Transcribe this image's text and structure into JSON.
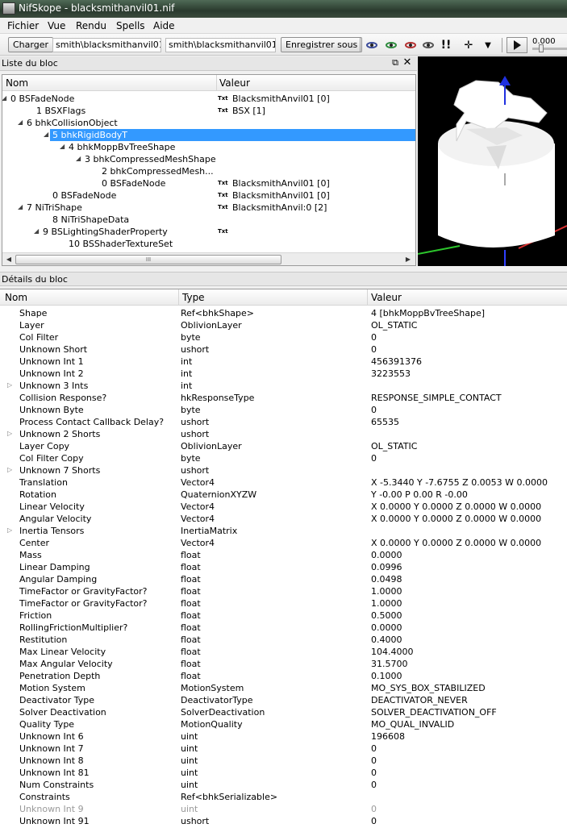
{
  "window": {
    "title": "NifSkope - blacksmithanvil01.nif"
  },
  "menu": {
    "items": [
      "Fichier",
      "Vue",
      "Rendu",
      "Spells",
      "Aide"
    ]
  },
  "toolbar": {
    "load_label": "Charger",
    "load_path": "smith\\blacksmithanvil01.nif",
    "save_path": "smith\\blacksmithanvil01.nif",
    "save_label": "Enregistrer sous",
    "time_value": "0.000"
  },
  "block_list": {
    "title": "Liste du bloc",
    "columns": {
      "name": "Nom",
      "value": "Valeur"
    },
    "rows": [
      {
        "name": "0 BSFadeNode",
        "txt": "Txt",
        "value": "BlacksmithAnvil01 [0]",
        "expander": "open"
      },
      {
        "name": "1 BSXFlags",
        "txt": "Txt",
        "value": "BSX [1]",
        "expander": ""
      },
      {
        "name": "6 bhkCollisionObject",
        "txt": "",
        "value": "",
        "expander": "open"
      },
      {
        "name": "5 bhkRigidBodyT",
        "txt": "",
        "value": "",
        "expander": "open"
      },
      {
        "name": "4 bhkMoppBvTreeShape",
        "txt": "",
        "value": "",
        "expander": "open"
      },
      {
        "name": "3 bhkCompressedMeshShape",
        "txt": "",
        "value": "",
        "expander": "open"
      },
      {
        "name": "2 bhkCompressedMesh...",
        "txt": "",
        "value": "",
        "expander": ""
      },
      {
        "name": "0 BSFadeNode",
        "txt": "Txt",
        "value": "BlacksmithAnvil01 [0]",
        "expander": ""
      },
      {
        "name": "0 BSFadeNode",
        "txt": "Txt",
        "value": "BlacksmithAnvil01 [0]",
        "expander": ""
      },
      {
        "name": "7 NiTriShape",
        "txt": "Txt",
        "value": "BlacksmithAnvil:0 [2]",
        "expander": "open"
      },
      {
        "name": "8 NiTriShapeData",
        "txt": "",
        "value": "",
        "expander": ""
      },
      {
        "name": "9 BSLightingShaderProperty",
        "txt": "Txt",
        "value": "",
        "expander": "open"
      },
      {
        "name": "10 BSShaderTextureSet",
        "txt": "",
        "value": "",
        "expander": ""
      }
    ],
    "scroll_thumb_grip": "III"
  },
  "details": {
    "title": "Détails du bloc",
    "columns": {
      "name": "Nom",
      "type": "Type",
      "value": "Valeur"
    },
    "rows": [
      {
        "name": "Shape",
        "type": "Ref<bhkShape>",
        "value": "4 [bhkMoppBvTreeShape]"
      },
      {
        "name": "Layer",
        "type": "OblivionLayer",
        "value": "OL_STATIC"
      },
      {
        "name": "Col Filter",
        "type": "byte",
        "value": "0"
      },
      {
        "name": "Unknown Short",
        "type": "ushort",
        "value": "0"
      },
      {
        "name": "Unknown Int 1",
        "type": "int",
        "value": "456391376"
      },
      {
        "name": "Unknown Int 2",
        "type": "int",
        "value": "3223553"
      },
      {
        "name": "Unknown 3 Ints",
        "type": "int",
        "value": "",
        "expander": true
      },
      {
        "name": "Collision Response?",
        "type": "hkResponseType",
        "value": "RESPONSE_SIMPLE_CONTACT"
      },
      {
        "name": "Unknown Byte",
        "type": "byte",
        "value": "0"
      },
      {
        "name": "Process Contact Callback Delay?",
        "type": "ushort",
        "value": "65535"
      },
      {
        "name": "Unknown 2 Shorts",
        "type": "ushort",
        "value": "",
        "expander": true
      },
      {
        "name": "Layer Copy",
        "type": "OblivionLayer",
        "value": "OL_STATIC"
      },
      {
        "name": "Col Filter Copy",
        "type": "byte",
        "value": "0"
      },
      {
        "name": "Unknown 7 Shorts",
        "type": "ushort",
        "value": "",
        "expander": true
      },
      {
        "name": "Translation",
        "type": "Vector4",
        "value": "X -5.3440 Y -7.6755 Z 0.0053 W 0.0000"
      },
      {
        "name": "Rotation",
        "type": "QuaternionXYZW",
        "value": "Y -0.00 P 0.00 R -0.00"
      },
      {
        "name": "Linear Velocity",
        "type": "Vector4",
        "value": "X 0.0000 Y 0.0000 Z 0.0000 W 0.0000"
      },
      {
        "name": "Angular Velocity",
        "type": "Vector4",
        "value": "X 0.0000 Y 0.0000 Z 0.0000 W 0.0000"
      },
      {
        "name": "Inertia Tensors",
        "type": "InertiaMatrix",
        "value": "",
        "expander": true
      },
      {
        "name": "Center",
        "type": "Vector4",
        "value": "X 0.0000 Y 0.0000 Z 0.0000 W 0.0000"
      },
      {
        "name": "Mass",
        "type": "float",
        "value": "0.0000"
      },
      {
        "name": "Linear Damping",
        "type": "float",
        "value": "0.0996"
      },
      {
        "name": "Angular Damping",
        "type": "float",
        "value": "0.0498"
      },
      {
        "name": "TimeFactor or GravityFactor?",
        "type": "float",
        "value": "1.0000"
      },
      {
        "name": "TimeFactor or GravityFactor?",
        "type": "float",
        "value": "1.0000"
      },
      {
        "name": "Friction",
        "type": "float",
        "value": "0.5000"
      },
      {
        "name": "RollingFrictionMultiplier?",
        "type": "float",
        "value": "0.0000"
      },
      {
        "name": "Restitution",
        "type": "float",
        "value": "0.4000"
      },
      {
        "name": "Max Linear Velocity",
        "type": "float",
        "value": "104.4000"
      },
      {
        "name": "Max Angular Velocity",
        "type": "float",
        "value": "31.5700"
      },
      {
        "name": "Penetration Depth",
        "type": "float",
        "value": "0.1000"
      },
      {
        "name": "Motion System",
        "type": "MotionSystem",
        "value": "MO_SYS_BOX_STABILIZED"
      },
      {
        "name": "Deactivator Type",
        "type": "DeactivatorType",
        "value": "DEACTIVATOR_NEVER"
      },
      {
        "name": "Solver Deactivation",
        "type": "SolverDeactivation",
        "value": "SOLVER_DEACTIVATION_OFF"
      },
      {
        "name": "Quality Type",
        "type": "MotionQuality",
        "value": "MO_QUAL_INVALID"
      },
      {
        "name": "Unknown Int 6",
        "type": "uint",
        "value": "196608"
      },
      {
        "name": "Unknown Int 7",
        "type": "uint",
        "value": "0"
      },
      {
        "name": "Unknown Int 8",
        "type": "uint",
        "value": "0"
      },
      {
        "name": "Unknown Int 81",
        "type": "uint",
        "value": "0"
      },
      {
        "name": "Num Constraints",
        "type": "uint",
        "value": "0"
      },
      {
        "name": "Constraints",
        "type": "Ref<bhkSerializable>",
        "value": ""
      },
      {
        "name": "Unknown Int 9",
        "type": "uint",
        "value": "0",
        "dim": true
      },
      {
        "name": "Unknown Int 91",
        "type": "ushort",
        "value": "0"
      }
    ]
  },
  "colors": {
    "selection": "#3399ff",
    "titlebar": "#2a3a2e",
    "dim_text": "#9a9a9a"
  }
}
